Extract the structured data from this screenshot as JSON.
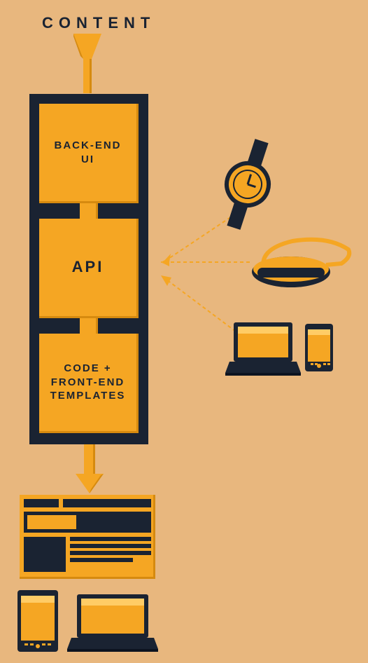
{
  "title": "CONTENT",
  "stack": {
    "box1": "BACK-END\nUI",
    "box2": "API",
    "box3": "CODE +\nFRONT-END\nTEMPLATES"
  },
  "colors": {
    "bg": "#e8b77e",
    "dark": "#1a2332",
    "orange": "#f5a623",
    "orangeDark": "#d68a0f"
  }
}
